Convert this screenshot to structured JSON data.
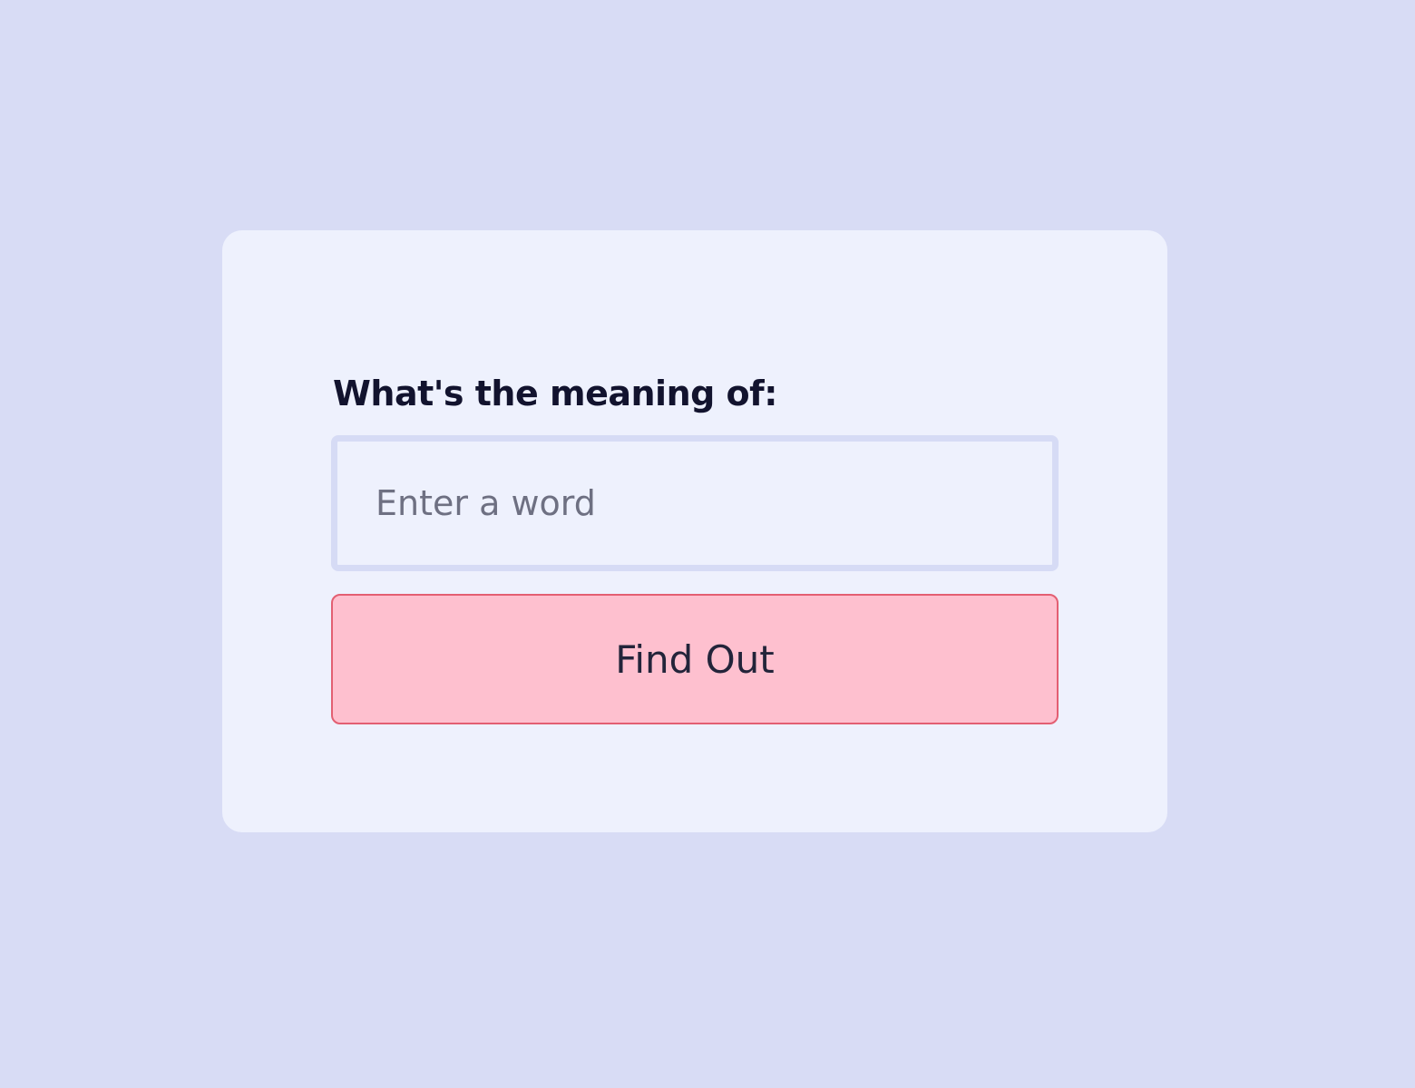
{
  "form": {
    "label": "What's the meaning of:",
    "input": {
      "value": "",
      "placeholder": "Enter a word"
    },
    "submit_label": "Find Out"
  },
  "colors": {
    "background": "#d8dcf5",
    "card": "#eef1fd",
    "input_border": "#d6dbf5",
    "button_fill": "#fec0cf",
    "button_border": "#e35f72",
    "text": "#12132e"
  }
}
